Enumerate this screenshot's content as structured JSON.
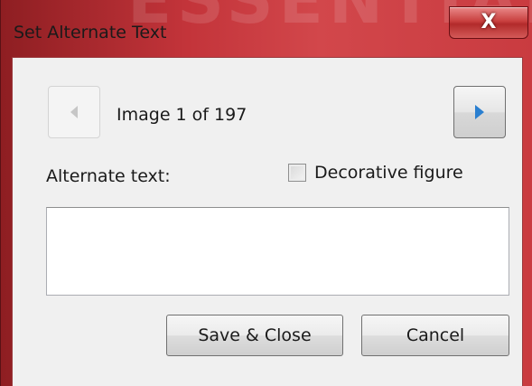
{
  "dialog": {
    "title": "Set Alternate Text",
    "close_label": "X"
  },
  "navigation": {
    "prev_icon": "triangle-left-icon",
    "next_icon": "triangle-right-icon",
    "counter": "Image 1 of 197",
    "current_image": 1,
    "total_images": 197
  },
  "alt_text": {
    "label": "Alternate text:",
    "value": ""
  },
  "decorative": {
    "label": "Decorative figure",
    "checked": false
  },
  "buttons": {
    "save_label": "Save & Close",
    "cancel_label": "Cancel"
  },
  "colors": {
    "titlebar": "#c3343a",
    "client_background": "#f0f0f0",
    "next_arrow": "#2a7fd0"
  }
}
